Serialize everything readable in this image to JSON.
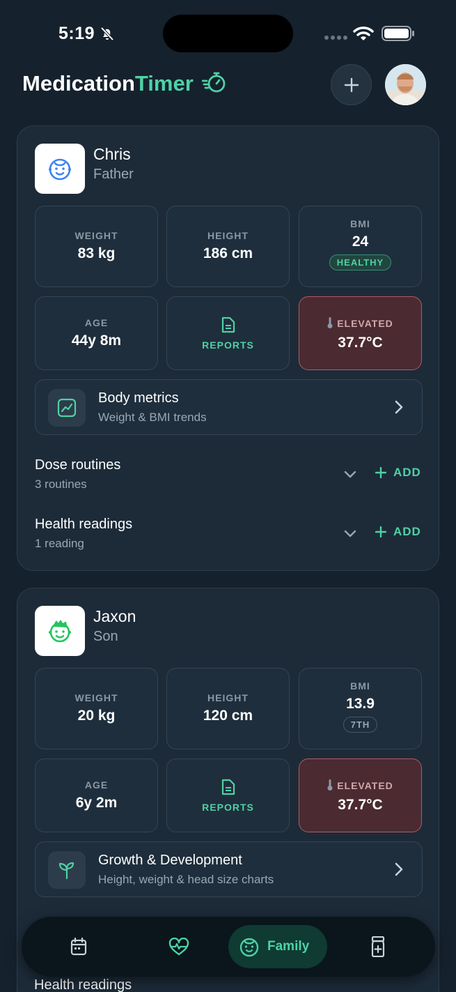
{
  "status_bar": {
    "time": "5:19"
  },
  "header": {
    "title_main": "Medication",
    "title_accent": "Timer"
  },
  "members": [
    {
      "name": "Chris",
      "role": "Father",
      "weight": {
        "label": "WEIGHT",
        "value": "83 kg"
      },
      "height": {
        "label": "HEIGHT",
        "value": "186 cm"
      },
      "bmi": {
        "label": "BMI",
        "value": "24",
        "badge": "HEALTHY"
      },
      "age": {
        "label": "AGE",
        "value": "44y 8m"
      },
      "reports": {
        "label": "REPORTS"
      },
      "temperature": {
        "label": "ELEVATED",
        "value": "37.7°C"
      },
      "link": {
        "title": "Body metrics",
        "subtitle": "Weight & BMI trends"
      },
      "sections": [
        {
          "title": "Dose routines",
          "count": "3 routines",
          "add": "ADD"
        },
        {
          "title": "Health readings",
          "count": "1 reading",
          "add": "ADD"
        }
      ]
    },
    {
      "name": "Jaxon",
      "role": "Son",
      "weight": {
        "label": "WEIGHT",
        "value": "20 kg"
      },
      "height": {
        "label": "HEIGHT",
        "value": "120 cm"
      },
      "bmi": {
        "label": "BMI",
        "value": "13.9",
        "badge": "7TH"
      },
      "age": {
        "label": "AGE",
        "value": "6y 2m"
      },
      "reports": {
        "label": "REPORTS"
      },
      "temperature": {
        "label": "ELEVATED",
        "value": "37.7°C"
      },
      "link": {
        "title": "Growth & Development",
        "subtitle": "Height, weight & head size charts"
      },
      "sections_peek": {
        "title": "Health readings"
      }
    }
  ],
  "bottom_nav": {
    "items": [
      {
        "icon": "calendar-icon"
      },
      {
        "icon": "heart-pulse-icon"
      },
      {
        "icon": "child-face-icon",
        "label": "Family",
        "active": true
      },
      {
        "icon": "medicine-bottle-icon"
      }
    ]
  },
  "colors": {
    "accent": "#4fd1a5",
    "background": "#15212d",
    "card": "#1d2b39",
    "elevated": "#4b2a31"
  }
}
